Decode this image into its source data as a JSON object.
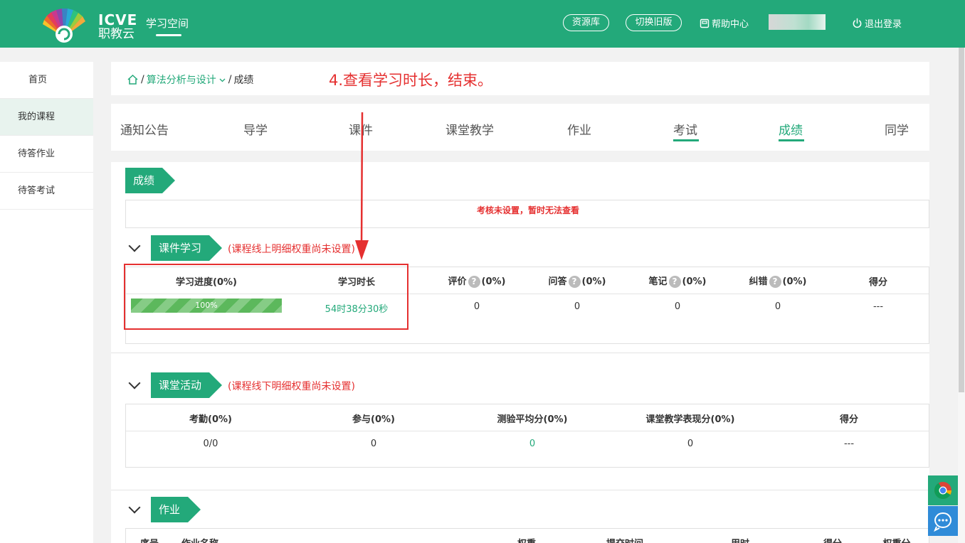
{
  "header": {
    "brand_top": "ICVE",
    "brand_bottom": "职教云",
    "space_title": "学习空间",
    "resource_btn": "资源库",
    "old_version_btn": "切换旧版",
    "help": "帮助中心",
    "logout": "退出登录",
    "color": "#23a97a"
  },
  "sidebar": {
    "items": [
      {
        "label": "首页"
      },
      {
        "label": "我的课程"
      },
      {
        "label": "待答作业"
      },
      {
        "label": "待答考试"
      }
    ]
  },
  "breadcrumb": {
    "course": "算法分析与设计",
    "current": "成绩"
  },
  "annotation": "4.查看学习时长，结束。",
  "tabs": [
    {
      "label": "通知公告"
    },
    {
      "label": "导学"
    },
    {
      "label": "课件"
    },
    {
      "label": "课堂教学"
    },
    {
      "label": "作业"
    },
    {
      "label": "考试"
    },
    {
      "label": "成绩"
    },
    {
      "label": "同学"
    }
  ],
  "grade": {
    "ribbon": "成绩",
    "notice": "考核未设置，暂时无法查看"
  },
  "courseware": {
    "ribbon": "课件学习",
    "note": "(课程线上明细权重尚未设置)",
    "headers": {
      "progress": "学习进度(0%)",
      "duration": "学习时长",
      "eval": "评价",
      "eval_pct": "(0%)",
      "qa": "问答",
      "qa_pct": "(0%)",
      "notes": "笔记",
      "notes_pct": "(0%)",
      "error": "纠错",
      "error_pct": "(0%)",
      "score": "得分"
    },
    "row": {
      "progress_label": "100%",
      "progress_value": 1.0,
      "duration": "54时38分30秒",
      "eval": "0",
      "qa": "0",
      "notes": "0",
      "error": "0",
      "score": "---"
    }
  },
  "classroom": {
    "ribbon": "课堂活动",
    "note": "(课程线下明细权重尚未设置)",
    "headers": [
      "考勤(0%)",
      "参与(0%)",
      "测验平均分(0%)",
      "课堂教学表现分(0%)",
      "得分"
    ],
    "row": [
      "0/0",
      "0",
      "0",
      "0",
      "---"
    ]
  },
  "homework": {
    "ribbon": "作业",
    "headers": [
      "序号",
      "作业名称",
      "权重",
      "提交时间",
      "用时",
      "得分",
      "权重分"
    ]
  }
}
